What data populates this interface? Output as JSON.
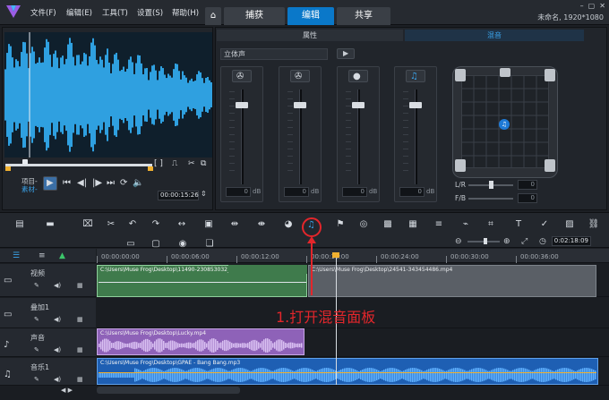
{
  "menu": [
    "文件(F)",
    "编辑(E)",
    "工具(T)",
    "设置(S)",
    "帮助(H)"
  ],
  "tabs": [
    "捕获",
    "编辑",
    "共享"
  ],
  "window": {
    "title": "未命名, 1920*1080"
  },
  "panel_tabs": {
    "attributes": "属性",
    "mixer": "混音"
  },
  "channel": {
    "label": "立体声"
  },
  "faders": [
    {
      "icon": "✇",
      "value": "0",
      "unit": "dB"
    },
    {
      "icon": "✇",
      "value": "0",
      "unit": "dB"
    },
    {
      "icon": "●",
      "value": "0",
      "unit": "dB"
    },
    {
      "icon": "♫",
      "value": "0",
      "unit": "dB"
    }
  ],
  "surround": {
    "lr_label": "L/R",
    "fb_label": "F/B",
    "lr_value": "0",
    "fb_value": "0"
  },
  "preview": {
    "project_label": "项目-",
    "clip_label": "素材-",
    "timecode": "00:00:15:26"
  },
  "timeline": {
    "ruler": [
      "00:00:00:00",
      "00:00:06:00",
      "00:00:12:00",
      "00:00:18:00",
      "00:00:24:00",
      "00:00:30:00",
      "00:00:36:00"
    ],
    "zoom_time": "0:02:18:09",
    "tracks": [
      {
        "name": "视频",
        "clips": [
          "C:\\Users\\Muse Frog\\Desktop\\11490-230853032_sr",
          "C:\\Users\\Muse Frog\\Desktop\\24541-343454486.mp4"
        ]
      },
      {
        "name": "叠加1",
        "clips": []
      },
      {
        "name": "声音",
        "clips": [
          "C:\\Users\\Muse Frog\\Desktop\\Lucky.mp4"
        ]
      },
      {
        "name": "音乐1",
        "clips": [
          "C:\\Users\\Muse Frog\\Desktop\\GPAE - Bang Bang.mp3"
        ]
      }
    ]
  },
  "annotation": "1.打开混音面板",
  "colors": {
    "accent": "#0a78c9",
    "annotation": "#e3262b",
    "video_clip": "#3f7b4c",
    "voice_clip": "#8e62b8",
    "music_clip": "#1e5fb3"
  }
}
